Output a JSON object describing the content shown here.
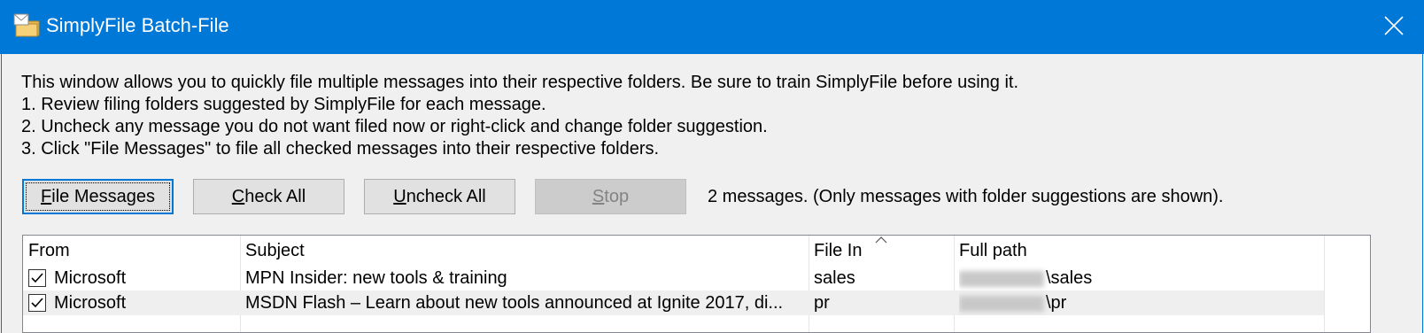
{
  "window": {
    "title": "SimplyFile Batch-File",
    "app_icon": "envelope-folder-icon",
    "close_icon": "close-icon",
    "accent": "#0078d7"
  },
  "instructions": [
    "This window allows you to quickly file multiple messages into their respective folders. Be sure to train SimplyFile before using it.",
    "1. Review filing folders suggested by SimplyFile for each message.",
    "2. Uncheck any message you do not want filed now or right-click and change folder suggestion.",
    "3. Click \"File Messages\" to file all checked messages into their respective folders."
  ],
  "buttons": {
    "file_messages": {
      "label": "File Messages",
      "mnemonic": "F",
      "rest": "ile Messages"
    },
    "check_all": {
      "label": "Check All",
      "mnemonic": "C",
      "rest": "heck All"
    },
    "uncheck_all": {
      "label": "Uncheck All",
      "mnemonic": "U",
      "rest": "ncheck All"
    },
    "stop": {
      "label": "Stop",
      "mnemonic": "S",
      "rest": "top",
      "enabled": false
    }
  },
  "status": "2 messages. (Only messages with folder suggestions are shown).",
  "table": {
    "columns": [
      "From",
      "Subject",
      "File In",
      "Full path"
    ],
    "sorted_column": "File In",
    "rows": [
      {
        "checked": true,
        "from": "Microsoft",
        "subject": "MPN Insider: new tools & training",
        "file_in": "sales",
        "path_suffix": "\\sales"
      },
      {
        "checked": true,
        "from": "Microsoft",
        "subject": "MSDN Flash – Learn about new tools announced at Ignite 2017, di...",
        "file_in": "pr",
        "path_suffix": "\\pr"
      }
    ]
  }
}
